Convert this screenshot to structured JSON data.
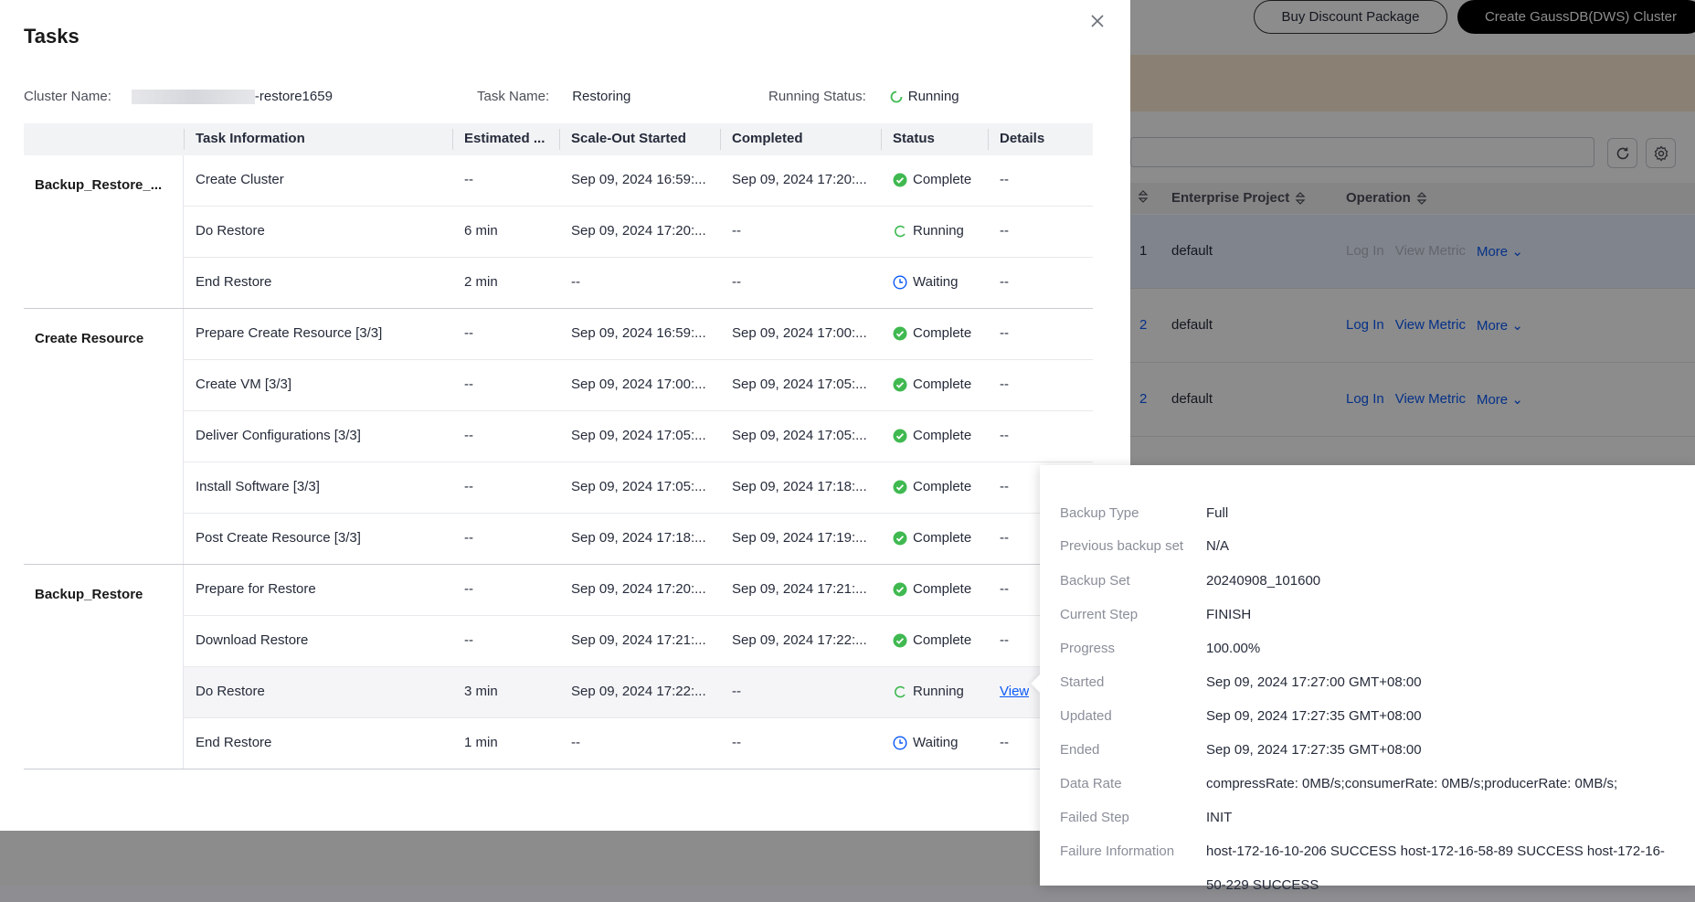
{
  "background": {
    "buy_button": "Buy Discount Package",
    "create_button": "Create GaussDB(DWS) Cluster",
    "table_headers": {
      "enterprise_project": "Enterprise Project",
      "operation": "Operation"
    },
    "rows": [
      {
        "num": "1",
        "project": "default",
        "ops": [
          "Log In",
          "View Metric",
          "More"
        ]
      },
      {
        "num": "2",
        "project": "default",
        "ops": [
          "Log In",
          "View Metric",
          "More"
        ]
      },
      {
        "num": "2",
        "project": "default",
        "ops": [
          "Log In",
          "View Metric",
          "More"
        ]
      }
    ]
  },
  "modal": {
    "title": "Tasks",
    "cluster_name_label": "Cluster Name:",
    "cluster_name_suffix": "-restore1659",
    "task_name_label": "Task Name:",
    "task_name": "Restoring",
    "running_status_label": "Running Status:",
    "running_status": "Running",
    "headers": [
      "Task Information",
      "Estimated ...",
      "Scale-Out Started",
      "Completed",
      "Status",
      "Details"
    ],
    "groups": [
      {
        "name": "Backup_Restore_...",
        "rows": [
          {
            "task": "Create Cluster",
            "est": "--",
            "start": "Sep 09, 2024 16:59:...",
            "comp": "Sep 09, 2024 17:20:...",
            "status": "Complete",
            "details": "--"
          },
          {
            "task": "Do Restore",
            "est": "6 min",
            "start": "Sep 09, 2024 17:20:...",
            "comp": "--",
            "status": "Running",
            "details": "--"
          },
          {
            "task": "End Restore",
            "est": "2 min",
            "start": "--",
            "comp": "--",
            "status": "Waiting",
            "details": "--"
          }
        ]
      },
      {
        "name": "Create Resource",
        "rows": [
          {
            "task": "Prepare Create Resource [3/3]",
            "est": "--",
            "start": "Sep 09, 2024 16:59:...",
            "comp": "Sep 09, 2024 17:00:...",
            "status": "Complete",
            "details": "--"
          },
          {
            "task": "Create VM [3/3]",
            "est": "--",
            "start": "Sep 09, 2024 17:00:...",
            "comp": "Sep 09, 2024 17:05:...",
            "status": "Complete",
            "details": "--"
          },
          {
            "task": "Deliver Configurations [3/3]",
            "est": "--",
            "start": "Sep 09, 2024 17:05:...",
            "comp": "Sep 09, 2024 17:05:...",
            "status": "Complete",
            "details": "--"
          },
          {
            "task": "Install Software [3/3]",
            "est": "--",
            "start": "Sep 09, 2024 17:05:...",
            "comp": "Sep 09, 2024 17:18:...",
            "status": "Complete",
            "details": "--"
          },
          {
            "task": "Post Create Resource [3/3]",
            "est": "--",
            "start": "Sep 09, 2024 17:18:...",
            "comp": "Sep 09, 2024 17:19:...",
            "status": "Complete",
            "details": "--"
          }
        ]
      },
      {
        "name": "Backup_Restore",
        "rows": [
          {
            "task": "Prepare for Restore",
            "est": "--",
            "start": "Sep 09, 2024 17:20:...",
            "comp": "Sep 09, 2024 17:21:...",
            "status": "Complete",
            "details": "--"
          },
          {
            "task": "Download Restore",
            "est": "--",
            "start": "Sep 09, 2024 17:21:...",
            "comp": "Sep 09, 2024 17:22:...",
            "status": "Complete",
            "details": "--"
          },
          {
            "task": "Do Restore",
            "est": "3 min",
            "start": "Sep 09, 2024 17:22:...",
            "comp": "--",
            "status": "Running",
            "details": "View"
          },
          {
            "task": "End Restore",
            "est": "1 min",
            "start": "--",
            "comp": "--",
            "status": "Waiting",
            "details": "--"
          }
        ]
      }
    ]
  },
  "popover": {
    "items": [
      {
        "key": "Backup Type",
        "value": "Full"
      },
      {
        "key": "Previous backup set",
        "value": "N/A"
      },
      {
        "key": "Backup Set",
        "value": "20240908_101600"
      },
      {
        "key": "Current Step",
        "value": "FINISH"
      },
      {
        "key": "Progress",
        "value": "100.00%"
      },
      {
        "key": "Started",
        "value": "Sep 09, 2024 17:27:00 GMT+08:00"
      },
      {
        "key": "Updated",
        "value": "Sep 09, 2024 17:27:35 GMT+08:00"
      },
      {
        "key": "Ended",
        "value": "Sep 09, 2024 17:27:35 GMT+08:00"
      },
      {
        "key": "Data Rate",
        "value": "compressRate: 0MB/s;consumerRate: 0MB/s;producerRate: 0MB/s;"
      },
      {
        "key": "Failed Step",
        "value": "INIT"
      },
      {
        "key": "Failure Information",
        "value": "host-172-16-10-206 SUCCESS host-172-16-58-89 SUCCESS host-172-16-50-229 SUCCESS"
      }
    ]
  },
  "colors": {
    "complete": "#3fb950",
    "running": "#3fb950",
    "waiting": "#0a59f7",
    "link": "#0a59f7"
  }
}
